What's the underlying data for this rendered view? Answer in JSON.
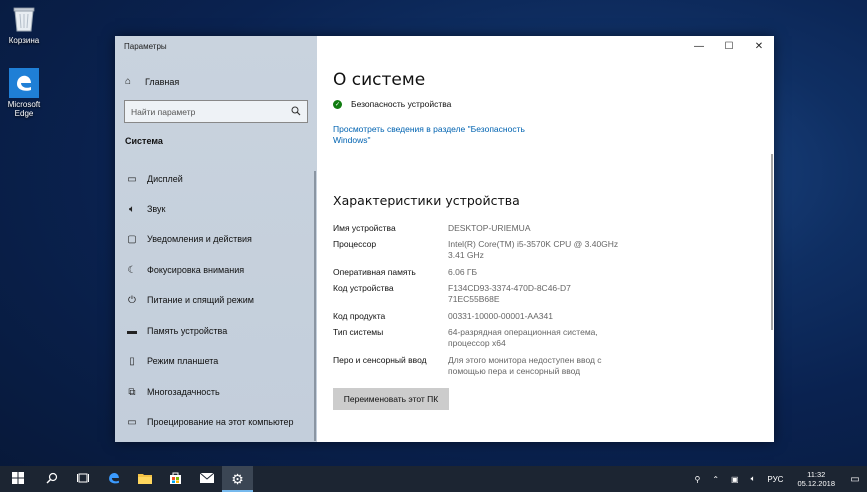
{
  "desktop": {
    "icons": [
      {
        "label": "Корзина",
        "icon": "recycle-bin-icon"
      },
      {
        "label": "Microsoft Edge",
        "icon": "edge-icon"
      }
    ]
  },
  "window": {
    "app_title": "Параметры",
    "controls": {
      "minimize": "—",
      "maximize": "☐",
      "close": "✕"
    }
  },
  "sidebar": {
    "home_label": "Главная",
    "search_placeholder": "Найти параметр",
    "section_title": "Система",
    "items": [
      {
        "label": "Дисплей",
        "icon": "display-icon"
      },
      {
        "label": "Звук",
        "icon": "sound-icon"
      },
      {
        "label": "Уведомления и действия",
        "icon": "notifications-icon"
      },
      {
        "label": "Фокусировка внимания",
        "icon": "focus-assist-icon"
      },
      {
        "label": "Питание и спящий режим",
        "icon": "power-icon"
      },
      {
        "label": "Память устройства",
        "icon": "storage-icon"
      },
      {
        "label": "Режим планшета",
        "icon": "tablet-icon"
      },
      {
        "label": "Многозадачность",
        "icon": "multitasking-icon"
      },
      {
        "label": "Проецирование на этот компьютер",
        "icon": "projecting-icon"
      }
    ]
  },
  "content": {
    "title": "О системе",
    "security_status": "Безопасность устройства",
    "security_link": "Просмотреть сведения в разделе \"Безопасность Windows\"",
    "specs_heading": "Характеристики устройства",
    "specs": [
      {
        "label": "Имя устройства",
        "value": "DESKTOP-URIEMUA"
      },
      {
        "label": "Процессор",
        "value": "Intel(R) Core(TM) i5-3570K CPU @ 3.40GHz 3.41 GHz"
      },
      {
        "label": "Оперативная память",
        "value": "6.06 ГБ"
      },
      {
        "label": "Код устройства",
        "value": "F134CD93-3374-470D-8C46-D771EC55B68E"
      },
      {
        "label": "Код продукта",
        "value": "00331-10000-00001-AA341"
      },
      {
        "label": "Тип системы",
        "value": "64-разрядная операционная система, процессор x64"
      },
      {
        "label": "Перо и сенсорный ввод",
        "value": "Для этого монитора недоступен ввод с помощью пера и сенсорный ввод"
      }
    ],
    "rename_button": "Переименовать этот ПК"
  },
  "taskbar": {
    "language": "РУС",
    "time": "11:32",
    "date": "05.12.2018"
  },
  "colors": {
    "accent": "#0063b1",
    "security_ok": "#107c10",
    "taskbar": "#1c2532"
  }
}
